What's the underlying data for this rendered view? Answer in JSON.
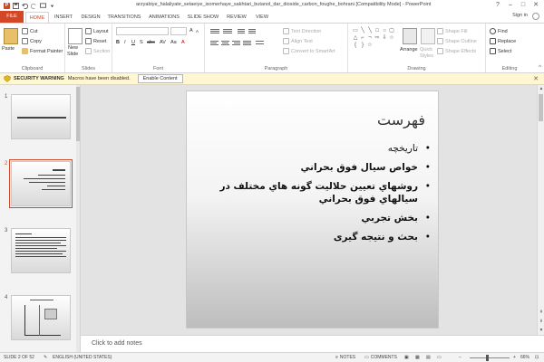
{
  "window": {
    "title": "arzyabiye_halaliyate_setaeiye_isomerhaye_sakhtari_butanol_dar_dioxide_carbon_foughe_bohrani [Compatibility Mode] - PowerPoint",
    "sign_in": "Sign in",
    "controls": [
      "?",
      "–",
      "□",
      "✕"
    ]
  },
  "tabs": [
    "FILE",
    "HOME",
    "INSERT",
    "DESIGN",
    "TRANSITIONS",
    "ANIMATIONS",
    "SLIDE SHOW",
    "REVIEW",
    "VIEW"
  ],
  "active_tab": "HOME",
  "ribbon": {
    "clipboard": {
      "label": "Clipboard",
      "paste": "Paste",
      "cut": "Cut",
      "copy": "Copy",
      "format_painter": "Format Painter"
    },
    "slides": {
      "label": "Slides",
      "new_slide": "New",
      "new_slide_2": "Slide",
      "layout": "Layout",
      "reset": "Reset",
      "section": "Section"
    },
    "font": {
      "label": "Font",
      "bold": "B",
      "italic": "I",
      "underline": "U",
      "shadow": "S",
      "strike": "abc",
      "spacing": "AV",
      "case": "Aa",
      "font_color": "A",
      "grow": "A",
      "shrink": "A"
    },
    "paragraph": {
      "label": "Paragraph",
      "text_direction": "Text Direction",
      "align_text": "Align Text",
      "convert_smartart": "Convert to SmartArt"
    },
    "drawing": {
      "label": "Drawing",
      "arrange": "Arrange",
      "quick_styles": "Quick",
      "quick_styles_2": "Styles",
      "shape_fill": "Shape Fill",
      "shape_outline": "Shape Outline",
      "shape_effects": "Shape Effects"
    },
    "editing": {
      "label": "Editing",
      "find": "Find",
      "replace": "Replace",
      "select": "Select"
    }
  },
  "security_bar": {
    "title": "SECURITY WARNING",
    "message": "Macros have been disabled.",
    "button": "Enable Content"
  },
  "slide_pane": {
    "thumbs": [
      {
        "num": "1"
      },
      {
        "num": "2"
      },
      {
        "num": "3"
      },
      {
        "num": "4"
      }
    ],
    "selected": 2
  },
  "slide": {
    "title": "فهرست",
    "bullets": [
      "تاريخچه",
      "خواص سيال فوق بحراني",
      "روشهاي تعيين حلاليت گونه هاي مختلف در سيالهاي فوق بحراني",
      "بخش تجربي",
      "بحث و نتيجه گيرى"
    ]
  },
  "notes": {
    "placeholder": "Click to add notes"
  },
  "status": {
    "slide": "SLIDE 2 OF 52",
    "language": "ENGLISH (UNITED STATES)",
    "notes": "NOTES",
    "comments": "COMMENTS",
    "zoom": "66%"
  },
  "colors": {
    "accent": "#d24726",
    "warning_bg": "#fff7d1"
  }
}
